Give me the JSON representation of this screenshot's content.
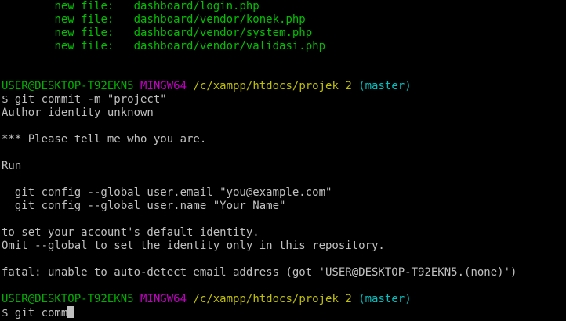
{
  "staged_files": [
    {
      "label": "new file:",
      "path": "dashboard/login.php"
    },
    {
      "label": "new file:",
      "path": "dashboard/vendor/konek.php"
    },
    {
      "label": "new file:",
      "path": "dashboard/vendor/system.php"
    },
    {
      "label": "new file:",
      "path": "dashboard/vendor/validasi.php"
    }
  ],
  "prompt1": {
    "user": "USER@DESKTOP-T92EKN5",
    "env": "MINGW64",
    "path": "/c/xampp/htdocs/projek_2",
    "branch": "(master)"
  },
  "command1": "$ git commit -m \"project\"",
  "output": {
    "l1": "Author identity unknown",
    "l2": "*** Please tell me who you are.",
    "l3": "Run",
    "l4": "  git config --global user.email \"you@example.com\"",
    "l5": "  git config --global user.name \"Your Name\"",
    "l6": "to set your account's default identity.",
    "l7": "Omit --global to set the identity only in this repository.",
    "l8": "fatal: unable to auto-detect email address (got 'USER@DESKTOP-T92EKN5.(none)')"
  },
  "prompt2": {
    "user": "USER@DESKTOP-T92EKN5",
    "env": "MINGW64",
    "path": "/c/xampp/htdocs/projek_2",
    "branch": "(master)"
  },
  "command2": "$ git comm"
}
